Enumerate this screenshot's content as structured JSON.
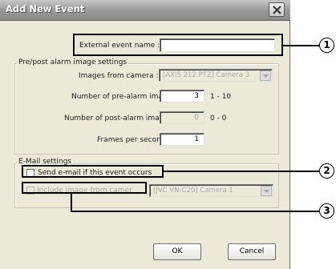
{
  "window": {
    "title": "Add New Event"
  },
  "external_event": {
    "label": "External event name :",
    "value": ""
  },
  "alarm_settings": {
    "legend": "Pre/post alarm image settings",
    "images_from_camera_label": "Images from camera :",
    "images_from_camera_value": "[AXIS 212 PTZ] Camera 3",
    "pre_alarm_label": "Number of pre-alarm images :",
    "pre_alarm_value": "3",
    "pre_alarm_range": "1 - 10",
    "post_alarm_label": "Number of post-alarm images :",
    "post_alarm_value": "0",
    "post_alarm_range": "0 - 0",
    "fps_label": "Frames per second :",
    "fps_value": "1"
  },
  "email_settings": {
    "legend": "E-Mail settings",
    "send_email_label": "Send e-mail if this event occurs",
    "send_email_checked": false,
    "include_image_label": "Include image from camer",
    "include_image_checked": false,
    "camera_value": "[JVC VN-C20] Camera 1"
  },
  "buttons": {
    "ok": "OK",
    "cancel": "Cancel"
  },
  "callouts": [
    "1",
    "2",
    "3"
  ],
  "icons": {
    "close": "close-icon",
    "dropdown": "chevron-down-icon"
  }
}
